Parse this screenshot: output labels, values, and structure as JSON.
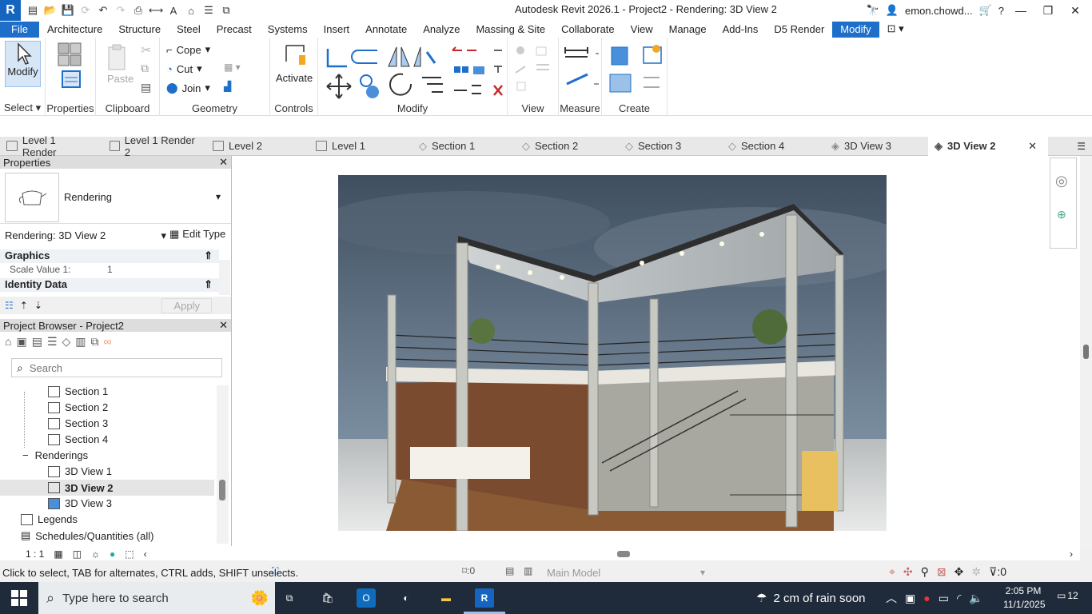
{
  "titlebar": {
    "app_title": "Autodesk Revit 2026.1 - Project2 - Rendering: 3D View 2",
    "user": "emon.chowd...",
    "colors": {
      "accent": "#1e6fc9"
    }
  },
  "ribbon_tabs": [
    "File",
    "Architecture",
    "Structure",
    "Steel",
    "Precast",
    "Systems",
    "Insert",
    "Annotate",
    "Analyze",
    "Massing & Site",
    "Collaborate",
    "View",
    "Manage",
    "Add-Ins",
    "D5 Render",
    "Modify"
  ],
  "active_tab": "Modify",
  "ribbon": {
    "select": {
      "label": "Modify",
      "panel": "Select"
    },
    "properties": {
      "panel": "Properties"
    },
    "clipboard": {
      "paste": "Paste",
      "panel": "Clipboard"
    },
    "geometry": {
      "cope": "Cope",
      "cut": "Cut",
      "join": "Join",
      "panel": "Geometry"
    },
    "controls": {
      "activate": "Activate",
      "panel": "Controls"
    },
    "modify": {
      "panel": "Modify"
    },
    "view": {
      "panel": "View"
    },
    "measure": {
      "panel": "Measure"
    },
    "create": {
      "panel": "Create"
    }
  },
  "view_tabs": [
    {
      "label": "Level 1 Render",
      "icon": "floor-plan-icon"
    },
    {
      "label": "Level 1 Render 2",
      "icon": "floor-plan-icon"
    },
    {
      "label": "Level 2",
      "icon": "floor-plan-icon"
    },
    {
      "label": "Level 1",
      "icon": "floor-plan-icon"
    },
    {
      "label": "Section 1",
      "icon": "section-icon"
    },
    {
      "label": "Section 2",
      "icon": "section-icon"
    },
    {
      "label": "Section 3",
      "icon": "section-icon"
    },
    {
      "label": "Section 4",
      "icon": "section-icon"
    },
    {
      "label": "3D View 3",
      "icon": "3d-view-icon"
    },
    {
      "label": "3D View 2",
      "icon": "3d-view-icon",
      "active": true
    }
  ],
  "properties": {
    "header": "Properties",
    "type_name": "Rendering",
    "selector": "Rendering: 3D View 2",
    "edit_type": "Edit Type",
    "groups": [
      {
        "name": "Graphics",
        "rows": [
          {
            "label": "Scale Value    1:",
            "value": "1"
          }
        ]
      },
      {
        "name": "Identity Data",
        "rows": []
      }
    ],
    "apply": "Apply"
  },
  "project_browser": {
    "header": "Project Browser - Project2",
    "search_placeholder": "Search",
    "items": [
      {
        "label": "Section 1",
        "level": 2
      },
      {
        "label": "Section 2",
        "level": 2
      },
      {
        "label": "Section 3",
        "level": 2
      },
      {
        "label": "Section 4",
        "level": 2
      },
      {
        "label": "Renderings",
        "level": 1,
        "expander": "−"
      },
      {
        "label": "3D View 1",
        "level": 2
      },
      {
        "label": "3D View 2",
        "level": 2,
        "selected": true
      },
      {
        "label": "3D View 3",
        "level": 2
      },
      {
        "label": "Legends",
        "level": 1
      },
      {
        "label": "Schedules/Quantities (all)",
        "level": 1
      }
    ]
  },
  "status": {
    "scale": "1 : 1",
    "hint": "Click to select, TAB for alternates, CTRL adds, SHIFT unselects.",
    "count": ":0",
    "model": "Main Model",
    "filter_count": ":0"
  },
  "taskbar": {
    "search_placeholder": "Type here to search",
    "weather": "2 cm of rain soon",
    "time": "2:05 PM",
    "date": "11/1/2025",
    "notifications": "12"
  }
}
